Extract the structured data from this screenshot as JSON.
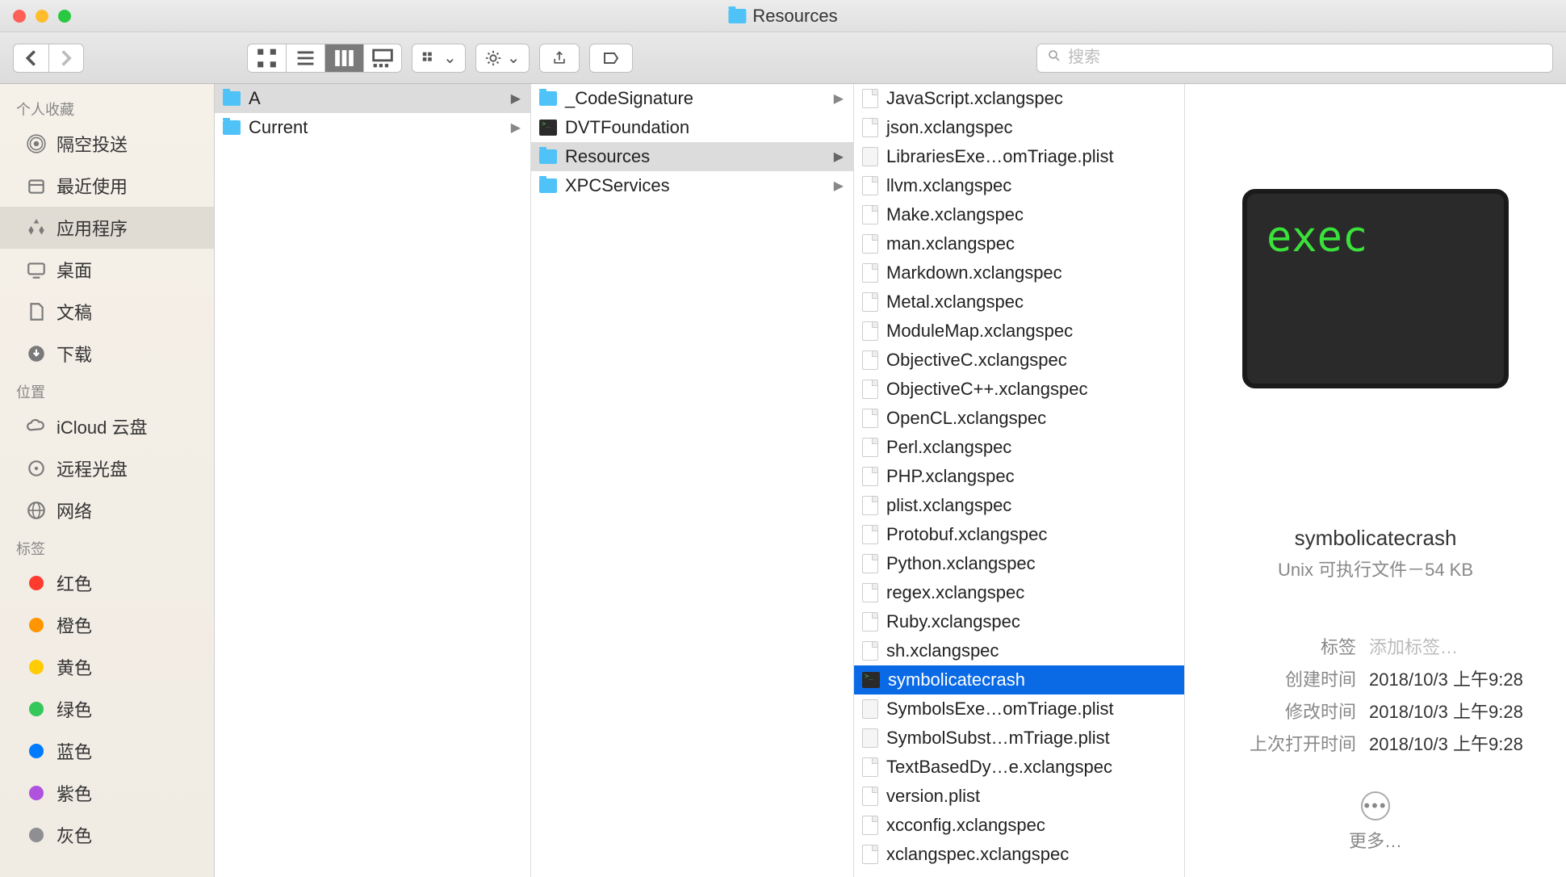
{
  "window": {
    "title": "Resources"
  },
  "toolbar": {
    "search_placeholder": "搜索"
  },
  "sidebar": {
    "sections": [
      {
        "title": "个人收藏",
        "items": [
          {
            "label": "隔空投送",
            "icon": "airdrop"
          },
          {
            "label": "最近使用",
            "icon": "recents"
          },
          {
            "label": "应用程序",
            "icon": "apps",
            "selected": true
          },
          {
            "label": "桌面",
            "icon": "desktop"
          },
          {
            "label": "文稿",
            "icon": "documents"
          },
          {
            "label": "下载",
            "icon": "downloads"
          }
        ]
      },
      {
        "title": "位置",
        "items": [
          {
            "label": "iCloud 云盘",
            "icon": "icloud"
          },
          {
            "label": "远程光盘",
            "icon": "remote-disc"
          },
          {
            "label": "网络",
            "icon": "network"
          }
        ]
      },
      {
        "title": "标签",
        "items": [
          {
            "label": "红色",
            "color": "#ff3b30"
          },
          {
            "label": "橙色",
            "color": "#ff9500"
          },
          {
            "label": "黄色",
            "color": "#ffcc00"
          },
          {
            "label": "绿色",
            "color": "#34c759"
          },
          {
            "label": "蓝色",
            "color": "#007aff"
          },
          {
            "label": "紫色",
            "color": "#af52de"
          },
          {
            "label": "灰色",
            "color": "#8e8e93"
          }
        ]
      }
    ]
  },
  "columns": [
    {
      "items": [
        {
          "name": "A",
          "type": "folder",
          "children": true,
          "selected": true
        },
        {
          "name": "Current",
          "type": "folder",
          "children": true
        }
      ]
    },
    {
      "items": [
        {
          "name": "_CodeSignature",
          "type": "folder",
          "children": true
        },
        {
          "name": "DVTFoundation",
          "type": "exec"
        },
        {
          "name": "Resources",
          "type": "folder",
          "children": true,
          "selected": true
        },
        {
          "name": "XPCServices",
          "type": "folder",
          "children": true
        }
      ]
    },
    {
      "items": [
        {
          "name": "JavaScript.xclangspec",
          "type": "file"
        },
        {
          "name": "json.xclangspec",
          "type": "file"
        },
        {
          "name": "LibrariesExe…omTriage.plist",
          "type": "plist"
        },
        {
          "name": "llvm.xclangspec",
          "type": "file"
        },
        {
          "name": "Make.xclangspec",
          "type": "file"
        },
        {
          "name": "man.xclangspec",
          "type": "file"
        },
        {
          "name": "Markdown.xclangspec",
          "type": "file"
        },
        {
          "name": "Metal.xclangspec",
          "type": "file"
        },
        {
          "name": "ModuleMap.xclangspec",
          "type": "file"
        },
        {
          "name": "ObjectiveC.xclangspec",
          "type": "file"
        },
        {
          "name": "ObjectiveC++.xclangspec",
          "type": "file"
        },
        {
          "name": "OpenCL.xclangspec",
          "type": "file"
        },
        {
          "name": "Perl.xclangspec",
          "type": "file"
        },
        {
          "name": "PHP.xclangspec",
          "type": "file"
        },
        {
          "name": "plist.xclangspec",
          "type": "file"
        },
        {
          "name": "Protobuf.xclangspec",
          "type": "file"
        },
        {
          "name": "Python.xclangspec",
          "type": "file"
        },
        {
          "name": "regex.xclangspec",
          "type": "file"
        },
        {
          "name": "Ruby.xclangspec",
          "type": "file"
        },
        {
          "name": "sh.xclangspec",
          "type": "file"
        },
        {
          "name": "symbolicatecrash",
          "type": "exec",
          "highlighted": true
        },
        {
          "name": "SymbolsExe…omTriage.plist",
          "type": "plist"
        },
        {
          "name": "SymbolSubst…mTriage.plist",
          "type": "plist"
        },
        {
          "name": "TextBasedDy…e.xclangspec",
          "type": "file"
        },
        {
          "name": "version.plist",
          "type": "file"
        },
        {
          "name": "xcconfig.xclangspec",
          "type": "file"
        },
        {
          "name": "xclangspec.xclangspec",
          "type": "file"
        }
      ]
    }
  ],
  "preview": {
    "thumb_text": "exec",
    "name": "symbolicatecrash",
    "kind_size": "Unix 可执行文件－54 KB",
    "tags_label": "标签",
    "tags_placeholder": "添加标签…",
    "created_label": "创建时间",
    "created_value": "2018/10/3 上午9:28",
    "modified_label": "修改时间",
    "modified_value": "2018/10/3 上午9:28",
    "opened_label": "上次打开时间",
    "opened_value": "2018/10/3 上午9:28",
    "more_label": "更多…"
  }
}
